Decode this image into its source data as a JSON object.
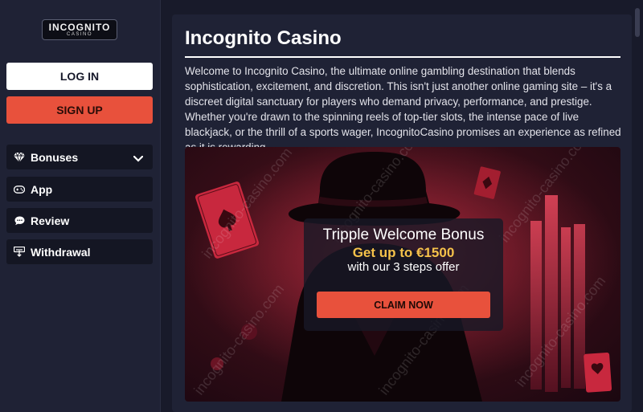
{
  "sidebar": {
    "logo": {
      "main": "INCOGNITO",
      "sub": "CASINO"
    },
    "login_label": "LOG IN",
    "signup_label": "SIGN UP",
    "items": [
      {
        "label": "Bonuses",
        "icon": "diamond-icon",
        "has_chevron": true
      },
      {
        "label": "App",
        "icon": "gamepad-icon"
      },
      {
        "label": "Review",
        "icon": "chat-bubble-icon"
      },
      {
        "label": "Withdrawal",
        "icon": "withdraw-icon"
      }
    ]
  },
  "main": {
    "title": "Incognito Casino",
    "intro": "Welcome to Incognito Casino, the ultimate online gambling destination that blends sophistication, excitement, and discretion. This isn't just another online gaming site – it's a discreet digital sanctuary for players who demand privacy, performance, and prestige. Whether you're drawn to the spinning reels of top-tier slots, the intense pace of live blackjack, or the thrill of a sports wager, IncognitoCasino promises an experience as refined as it is rewarding.",
    "banner": {
      "title": "Tripple Welcome Bonus",
      "amount": "Get up to €1500",
      "subtitle": "with our 3 steps offer",
      "button_label": "CLAIM NOW",
      "watermark": "incognito-casino.com"
    }
  },
  "colors": {
    "accent": "#e8513c",
    "gold": "#f5c24a",
    "sidebar_bg": "#1f2235",
    "page_bg": "#181a2a"
  }
}
